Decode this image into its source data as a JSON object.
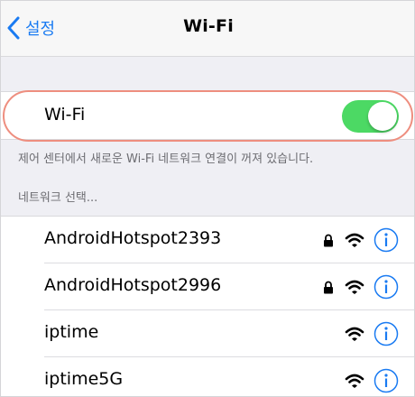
{
  "navbar": {
    "back_label": "설정",
    "title": "Wi-Fi"
  },
  "wifi_toggle": {
    "label": "Wi-Fi",
    "state": "on",
    "on_color": "#4cd964"
  },
  "highlight_color": "#ee8e7f",
  "accent_color": "#1a7bf2",
  "footnote": "제어 센터에서 새로운 Wi-Fi 네트워크 연결이 꺼져 있습니다.",
  "section_header": "네트워크 선택...",
  "networks": [
    {
      "name": "AndroidHotspot2393",
      "secured": true,
      "icons": [
        "lock-icon",
        "wifi-icon",
        "info-icon"
      ]
    },
    {
      "name": "AndroidHotspot2996",
      "secured": true,
      "icons": [
        "lock-icon",
        "wifi-icon",
        "info-icon"
      ]
    },
    {
      "name": "iptime",
      "secured": false,
      "icons": [
        "wifi-icon",
        "info-icon"
      ]
    },
    {
      "name": "iptime5G",
      "secured": false,
      "icons": [
        "wifi-icon",
        "info-icon"
      ]
    }
  ]
}
